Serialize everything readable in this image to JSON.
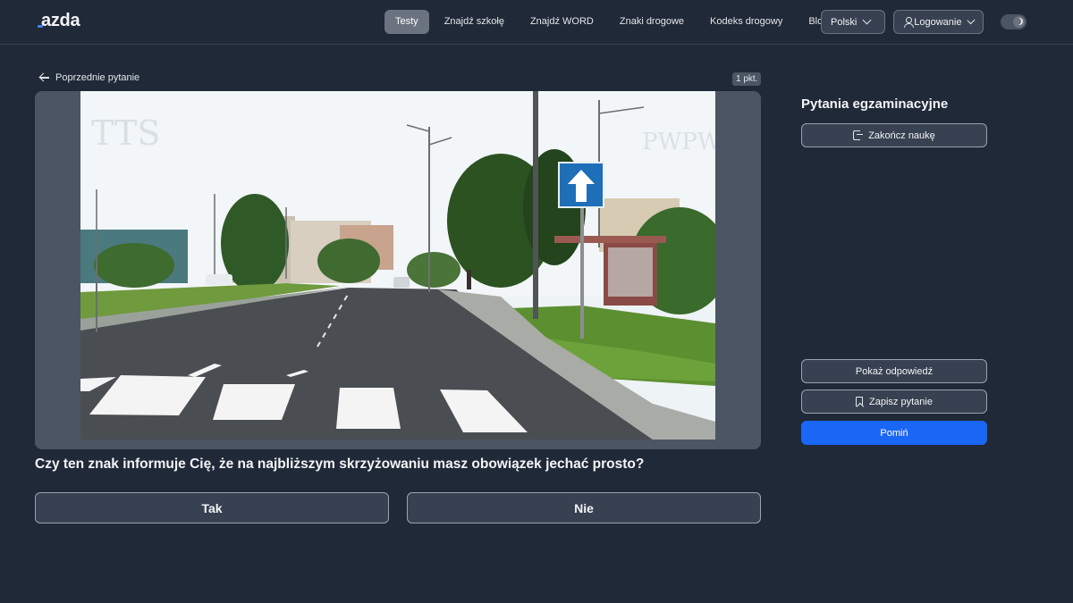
{
  "brand": {
    "logo_text": "azda"
  },
  "nav": {
    "items": [
      {
        "label": "Testy",
        "active": true
      },
      {
        "label": "Znajdź szkołę",
        "active": false
      },
      {
        "label": "Znajdź WORD",
        "active": false
      },
      {
        "label": "Znaki drogowe",
        "active": false
      },
      {
        "label": "Kodeks drogowy",
        "active": false
      },
      {
        "label": "Blog",
        "active": false
      }
    ],
    "language_label": "Polski",
    "login_label": "Logowanie"
  },
  "question": {
    "prev_label": "Poprzednie pytanie",
    "points": "1 pkt.",
    "text": "Czy ten znak informuje Cię, że na najbliższym skrzyżowaniu masz obowiązek jechać prosto?",
    "answers": [
      {
        "label": "Tak"
      },
      {
        "label": "Nie"
      }
    ],
    "media": {
      "watermark_left": "TTS",
      "watermark_right": "PWPW",
      "icon": "one-way-road-sign"
    }
  },
  "side": {
    "title": "Pytania egzaminacyjne",
    "end_label": "Zakończ naukę",
    "show_answer_label": "Pokaż odpowiedź",
    "save_label": "Zapisz pytanie",
    "skip_label": "Pomiń"
  },
  "colors": {
    "background": "#1f2937",
    "accent": "#1a66f5",
    "active_nav": "#6b7280"
  }
}
